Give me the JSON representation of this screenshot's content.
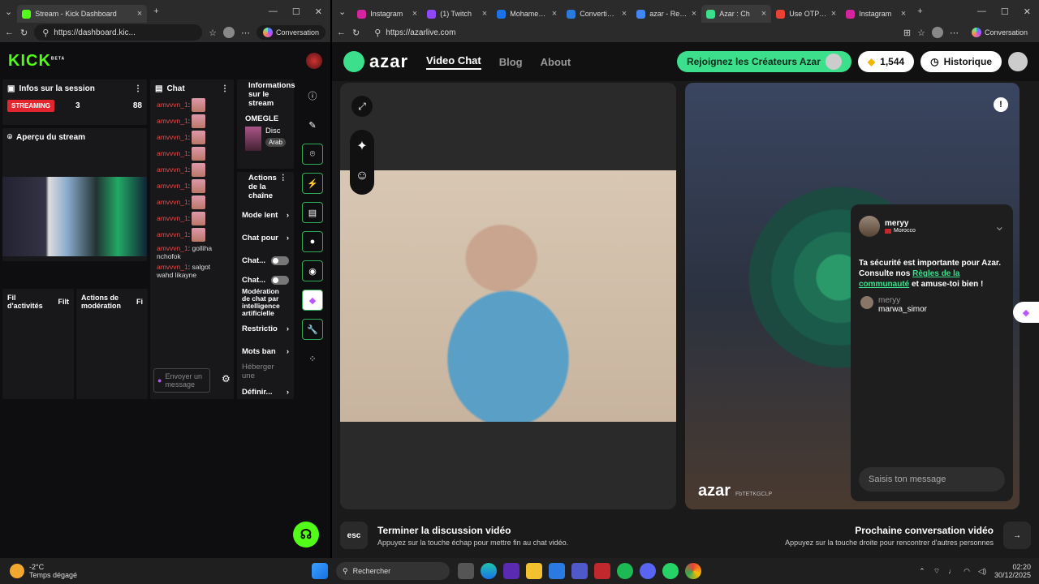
{
  "left": {
    "tabs": [
      {
        "label": "Stream - Kick Dashboard",
        "color": "#53fc18"
      }
    ],
    "url": "https://dashboard.kic...",
    "conversation_label": "Conversation",
    "logo": "KICK",
    "logo_beta": "BETA",
    "session": {
      "title": "Infos sur la session",
      "status": "STREAMING",
      "viewers": "3",
      "count": "88"
    },
    "preview": {
      "title": "Aperçu du stream"
    },
    "chat": {
      "title": "Chat",
      "user": "amvvvn_1",
      "messages": [
        {
          "user": "amvvvn_1",
          "text": ""
        },
        {
          "user": "amvvvn_1",
          "text": ""
        },
        {
          "user": "amvvvn_1",
          "text": ""
        },
        {
          "user": "amvvvn_1",
          "text": ""
        },
        {
          "user": "amvvvn_1",
          "text": ""
        },
        {
          "user": "amvvvn_1",
          "text": ""
        },
        {
          "user": "amvvvn_1",
          "text": ""
        },
        {
          "user": "amvvvn_1",
          "text": ""
        },
        {
          "user": "amvvvn_1",
          "text": ""
        },
        {
          "user": "amvvvn_1",
          "text": "golliha nchofok"
        },
        {
          "user": "amvvvn_1",
          "text": "salgot wahd likayne"
        }
      ],
      "input_placeholder": "Envoyer un message"
    },
    "info": {
      "title": "Informations sur le stream",
      "category": "OMEGLE",
      "line1": "Disc",
      "tag": "Arab"
    },
    "actions": {
      "title": "Actions de la chaîne",
      "items": [
        "Mode lent",
        "Chat pour",
        "Chat...",
        "Chat..."
      ],
      "mod_title": "Modération de chat par intelligence artificielle",
      "items2": [
        "Restrictio",
        "Mots ban"
      ],
      "host": "Héberger une",
      "define": "Définir..."
    },
    "activity": {
      "title": "Fil d'activités",
      "filter": "Filt"
    },
    "modactions": {
      "title": "Actions de modération",
      "filter": "Fi"
    }
  },
  "right": {
    "tabs": [
      {
        "label": "Instagram",
        "color": "#d6249f"
      },
      {
        "label": "(1) Twitch",
        "color": "#9146ff"
      },
      {
        "label": "Mohamed Ra",
        "color": "#1a73e8"
      },
      {
        "label": "Convertisseur",
        "color": "#2a7ae2"
      },
      {
        "label": "azar - Recher",
        "color": "#4285f4"
      },
      {
        "label": "Azar : Ch",
        "color": "#3ce08c"
      },
      {
        "label": "Use OTP To P",
        "color": "#ea4335"
      },
      {
        "label": "Instagram",
        "color": "#d6249f"
      }
    ],
    "url": "https://azarlive.com",
    "conversation_label": "Conversation",
    "nav": {
      "logo": "azar",
      "items": [
        "Video Chat",
        "Blog",
        "About"
      ],
      "creators": "Rejoignez les Créateurs Azar",
      "gems": "1,544",
      "history": "Historique"
    },
    "partner": {
      "name": "meryy",
      "country": "Morocco",
      "watermark": "azar",
      "wm_id": "FbTETKGCLP"
    },
    "chat": {
      "safety_1": "Ta sécurité est importante pour Azar. Consulte nos ",
      "safety_link": "Règles de la communauté",
      "safety_2": " et amuse-toi bien !",
      "msg_user": "meryy",
      "msg_text": "marwa_simor",
      "placeholder": "Saisis ton message"
    },
    "end": {
      "key": "esc",
      "title": "Terminer la discussion vidéo",
      "sub": "Appuyez sur la touche échap pour mettre fin au chat vidéo."
    },
    "next": {
      "title": "Prochaine conversation vidéo",
      "sub": "Appuyez sur la touche droite pour rencontrer d'autres personnes"
    }
  },
  "taskbar": {
    "temp": "-2°C",
    "weather": "Temps dégagé",
    "search": "Rechercher",
    "time": "02:20",
    "date": "30/12/2025"
  },
  "colors": {
    "kick_green": "#53fc18",
    "azar_green": "#3ce08c",
    "streaming_red": "#e3262e"
  }
}
